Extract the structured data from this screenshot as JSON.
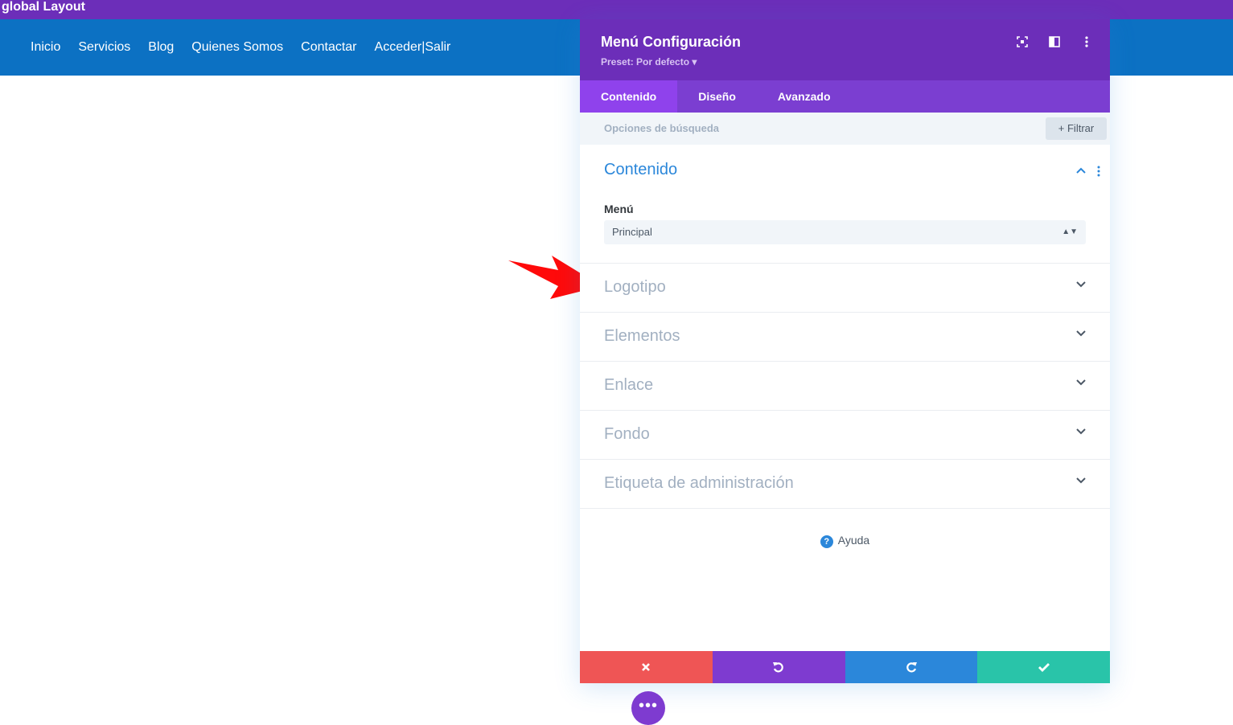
{
  "layout_title": "global Layout",
  "nav": {
    "items": [
      "Inicio",
      "Servicios",
      "Blog",
      "Quienes Somos",
      "Contactar",
      "Acceder|Salir"
    ]
  },
  "modal": {
    "title": "Menú Configuración",
    "preset": "Preset: Por defecto ▾",
    "tabs": [
      "Contenido",
      "Diseño",
      "Avanzado"
    ],
    "search_placeholder": "Opciones de búsqueda",
    "filter_label": "+ Filtrar",
    "open_section": {
      "title": "Contenido",
      "field_label": "Menú",
      "select_value": "Principal"
    },
    "sections": [
      "Logotipo",
      "Elementos",
      "Enlace",
      "Fondo",
      "Etiqueta de administración"
    ],
    "help_label": "Ayuda"
  },
  "colors": {
    "purple": "#6c2eb9",
    "nav_blue": "#0c71c3",
    "accent_blue": "#2b87da",
    "cancel_red": "#ef5555",
    "save_green": "#29c4a9",
    "annotation_arrow": "#ff0000"
  }
}
